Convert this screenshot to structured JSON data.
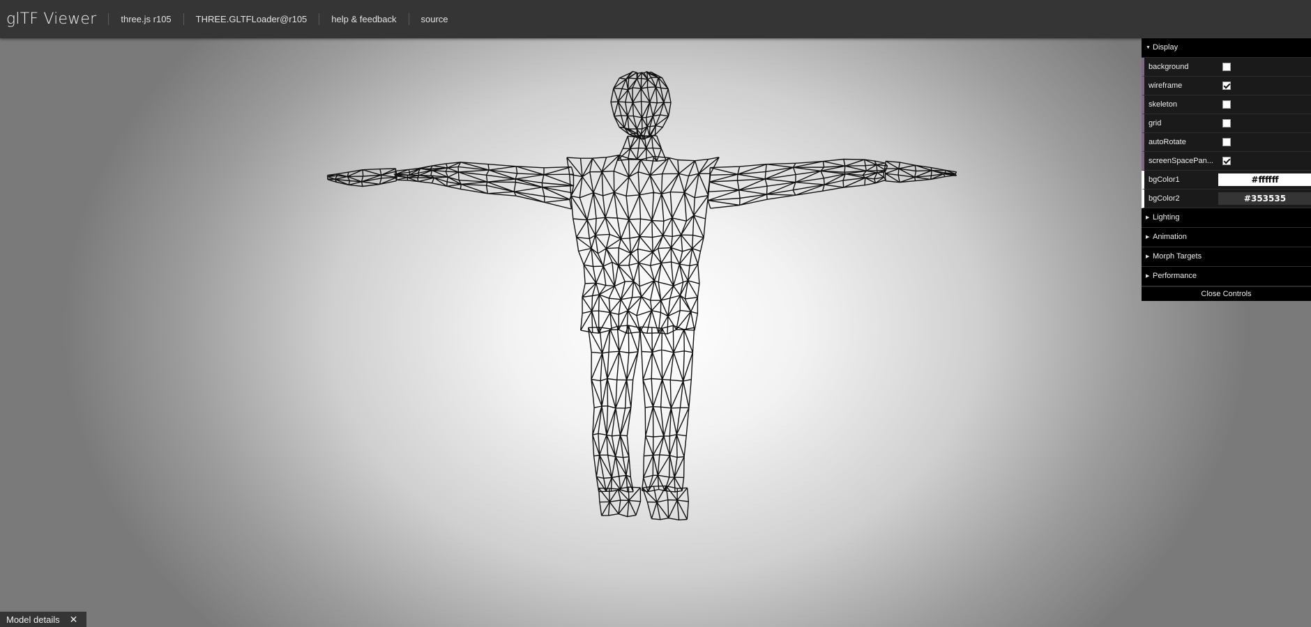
{
  "header": {
    "title": "glTF Viewer",
    "links": [
      "three.js r105",
      "THREE.GLTFLoader@r105",
      "help & feedback",
      "source"
    ]
  },
  "controls": {
    "display_folder": "Display",
    "rows": [
      {
        "label": "background",
        "checked": false
      },
      {
        "label": "wireframe",
        "checked": true
      },
      {
        "label": "skeleton",
        "checked": false
      },
      {
        "label": "grid",
        "checked": false
      },
      {
        "label": "autoRotate",
        "checked": false
      },
      {
        "label": "screenSpacePan...",
        "checked": true
      }
    ],
    "bgColor1": {
      "label": "bgColor1",
      "value": "#ffffff"
    },
    "bgColor2": {
      "label": "bgColor2",
      "value": "#353535"
    },
    "folders": [
      "Lighting",
      "Animation",
      "Morph Targets",
      "Performance"
    ],
    "close_label": "Close Controls"
  },
  "footer": {
    "model_details": "Model details",
    "close_glyph": "✕"
  },
  "colors": {
    "header_bg": "#353535",
    "panel_bg": "#000000",
    "row_accent": "#806787",
    "wire": "#111111"
  },
  "icons": [
    "collapse-triangle-icon",
    "expand-triangle-icon",
    "checkbox-icon",
    "close-icon"
  ]
}
